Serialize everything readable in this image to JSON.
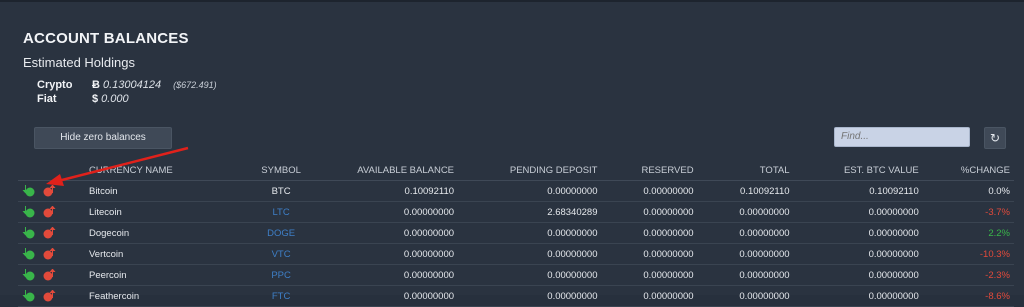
{
  "header": {
    "title": "ACCOUNT BALANCES",
    "subtitle": "Estimated Holdings"
  },
  "holdings": {
    "crypto_label": "Crypto",
    "crypto_symbol": "Ƀ",
    "crypto_value": "0.13004124",
    "crypto_usd": "($672.491)",
    "fiat_label": "Fiat",
    "fiat_symbol": "$",
    "fiat_value": "0.000"
  },
  "controls": {
    "hide_zero_label": "Hide zero balances",
    "find_placeholder": "Find...",
    "refresh_icon": "↻"
  },
  "table": {
    "columns": [
      "CURRENCY NAME",
      "SYMBOL",
      "AVAILABLE BALANCE",
      "PENDING DEPOSIT",
      "RESERVED",
      "TOTAL",
      "EST. BTC VALUE",
      "%CHANGE"
    ],
    "rows": [
      {
        "name": "Bitcoin",
        "symbol": "BTC",
        "available": "0.10092110",
        "pending": "0.00000000",
        "reserved": "0.00000000",
        "total": "0.10092110",
        "btc_value": "0.10092110",
        "change": "0.0%"
      },
      {
        "name": "Litecoin",
        "symbol": "LTC",
        "available": "0.00000000",
        "pending": "2.68340289",
        "reserved": "0.00000000",
        "total": "0.00000000",
        "btc_value": "0.00000000",
        "change": "-3.7%"
      },
      {
        "name": "Dogecoin",
        "symbol": "DOGE",
        "available": "0.00000000",
        "pending": "0.00000000",
        "reserved": "0.00000000",
        "total": "0.00000000",
        "btc_value": "0.00000000",
        "change": "2.2%"
      },
      {
        "name": "Vertcoin",
        "symbol": "VTC",
        "available": "0.00000000",
        "pending": "0.00000000",
        "reserved": "0.00000000",
        "total": "0.00000000",
        "btc_value": "0.00000000",
        "change": "-10.3%"
      },
      {
        "name": "Peercoin",
        "symbol": "PPC",
        "available": "0.00000000",
        "pending": "0.00000000",
        "reserved": "0.00000000",
        "total": "0.00000000",
        "btc_value": "0.00000000",
        "change": "-2.3%"
      },
      {
        "name": "Feathercoin",
        "symbol": "FTC",
        "available": "0.00000000",
        "pending": "0.00000000",
        "reserved": "0.00000000",
        "total": "0.00000000",
        "btc_value": "0.00000000",
        "change": "-8.6%"
      }
    ]
  },
  "icons": {
    "deposit": "deposit-icon",
    "withdraw": "withdraw-icon"
  },
  "colors": {
    "positive": "#39b54a",
    "negative": "#e24a3b",
    "link": "#3e7fc7",
    "annotation_arrow": "#e0211b"
  }
}
